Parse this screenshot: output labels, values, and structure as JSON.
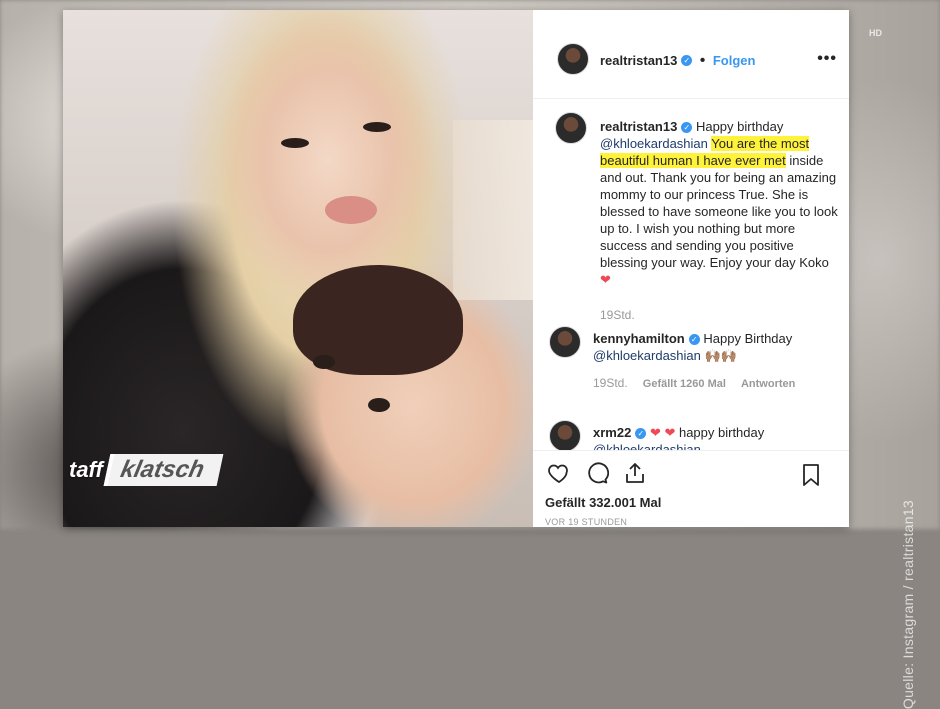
{
  "overlay": {
    "source_credit": "Quelle: Instagram / realtristan13",
    "channel_mark": "HD",
    "show_logo_1": "taff",
    "show_logo_2": "klatsch"
  },
  "post": {
    "header": {
      "username": "realtristan13",
      "separator": "•",
      "follow_label": "Folgen",
      "more_icon": "more-options-icon"
    },
    "caption": {
      "username": "realtristan13",
      "text_intro": "Happy birthday",
      "mention": "@khloekardashian",
      "highlighted": "You are the most beautiful human I have ever met",
      "text_rest": "inside and out. Thank you for being an amazing mommy to our princess True. She is blessed to have someone like you to look up to. I wish you nothing but more success and sending you positive blessing your way. Enjoy your day Koko",
      "emoji": "❤",
      "time": "19Std."
    },
    "comments": [
      {
        "username": "kennyhamilton",
        "text": "Happy Birthday",
        "mention": "@khloekardashian",
        "emoji": "🙌🏽🙌🏽",
        "time": "19Std.",
        "likes": "Gefällt 1260 Mal",
        "reply": "Antworten"
      },
      {
        "username": "xrm22",
        "emoji": "❤ ❤",
        "text": "happy birthday",
        "mention": "@khloekardashian"
      }
    ],
    "footer": {
      "likes": "Gefällt 332.001 Mal",
      "age": "VOR 19 STUNDEN"
    },
    "colors": {
      "verified": "#3897f0",
      "follow": "#3897f0",
      "heart": "#ed4956",
      "highlight": "#fff23a"
    }
  }
}
